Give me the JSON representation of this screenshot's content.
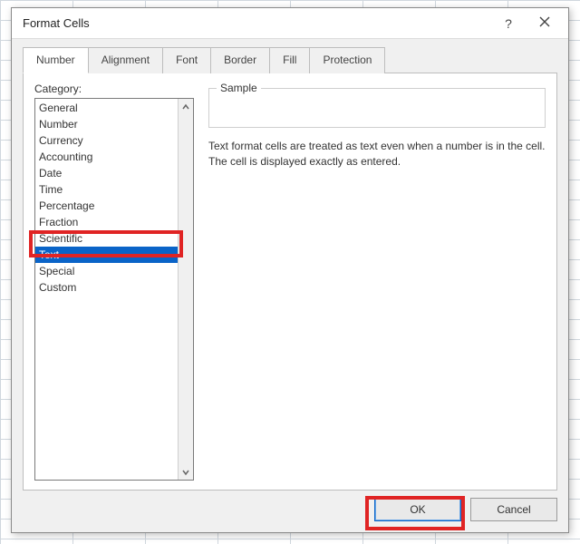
{
  "dialog": {
    "title": "Format Cells"
  },
  "tabs": {
    "items": [
      {
        "label": "Number"
      },
      {
        "label": "Alignment"
      },
      {
        "label": "Font"
      },
      {
        "label": "Border"
      },
      {
        "label": "Fill"
      },
      {
        "label": "Protection"
      }
    ],
    "active_index": 0
  },
  "category": {
    "label": "Category:",
    "items": [
      "General",
      "Number",
      "Currency",
      "Accounting",
      "Date",
      "Time",
      "Percentage",
      "Fraction",
      "Scientific",
      "Text",
      "Special",
      "Custom"
    ],
    "selected_index": 9
  },
  "sample": {
    "label": "Sample",
    "value": ""
  },
  "description": "Text format cells are treated as text even when a number is in the cell. The cell is displayed exactly as entered.",
  "buttons": {
    "ok": "OK",
    "cancel": "Cancel"
  }
}
